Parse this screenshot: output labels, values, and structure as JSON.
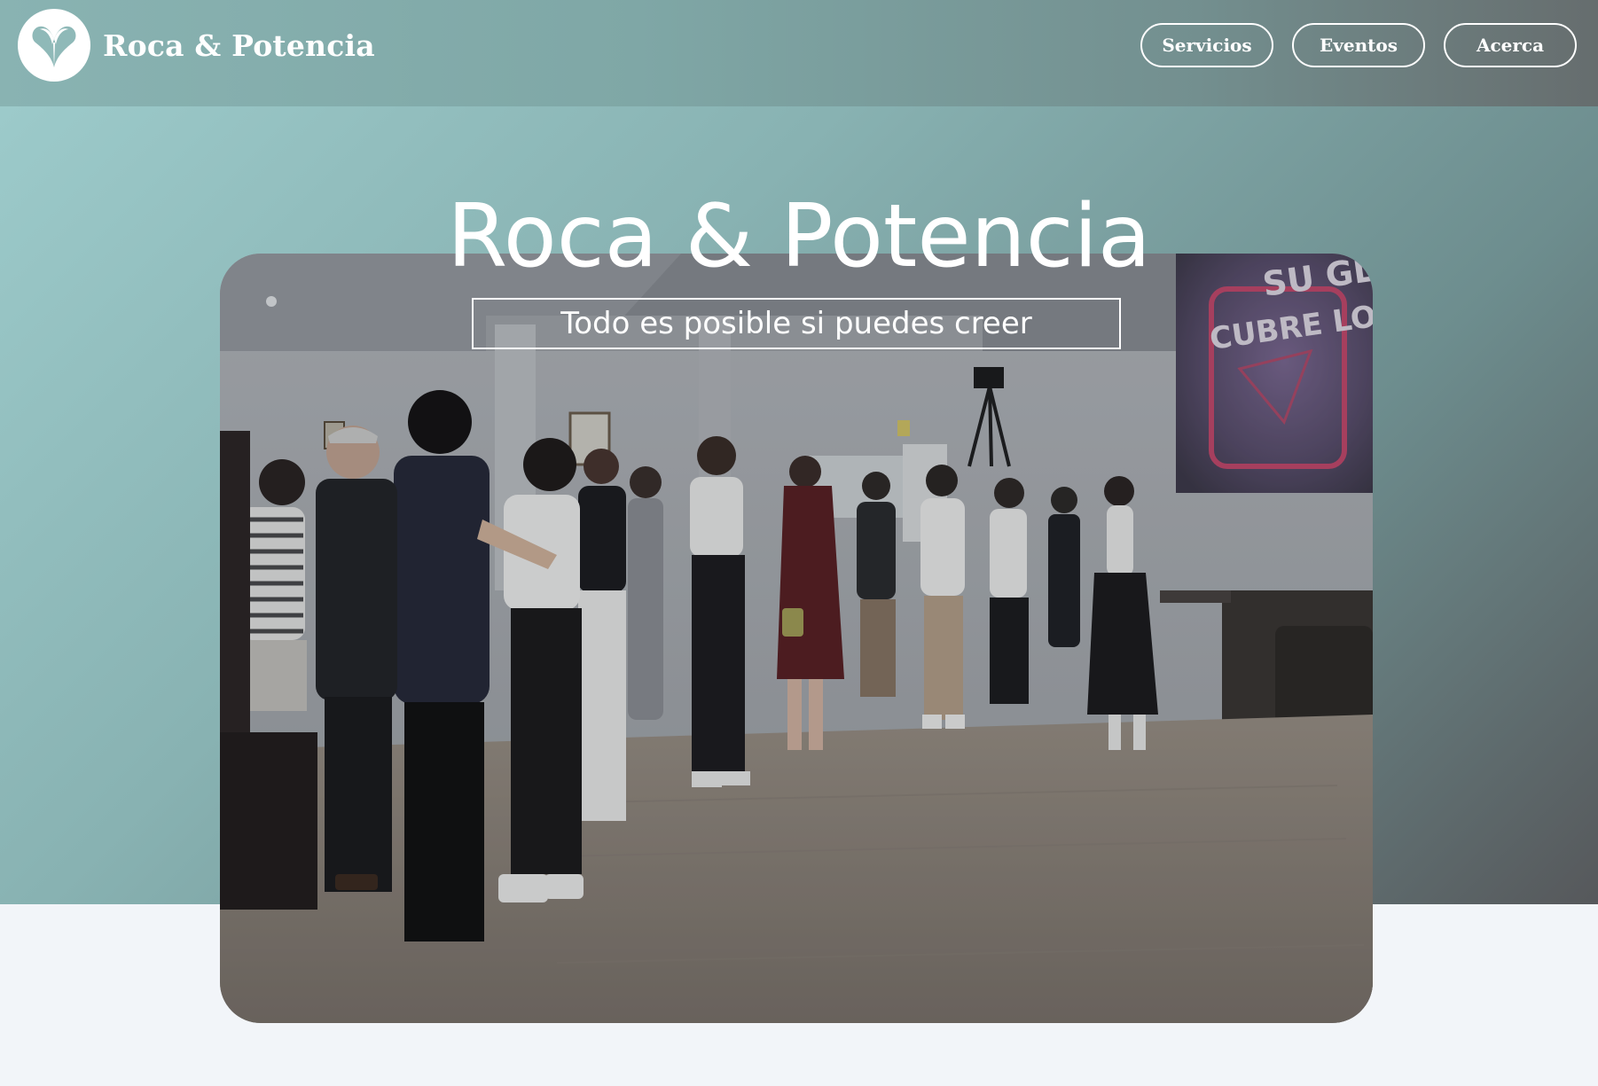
{
  "header": {
    "brand_name": "Roca & Potencia",
    "logo_icon": "leaf-heart-icon",
    "nav": [
      {
        "label": "Servicios"
      },
      {
        "label": "Eventos"
      },
      {
        "label": "Acerca"
      }
    ]
  },
  "hero": {
    "title": "Roca & Potencia",
    "subtitle": "Todo es posible si puedes creer",
    "image": {
      "screen_text_line1": "SU GL",
      "screen_text_line2": "CUBRE LOS"
    }
  },
  "colors": {
    "header_gradient": [
      "#89b3b2",
      "#666d6e"
    ],
    "hero_gradient": [
      "#9ccaca",
      "#56585b"
    ],
    "page_background": "#f2f5f9",
    "text": "#ffffff"
  }
}
